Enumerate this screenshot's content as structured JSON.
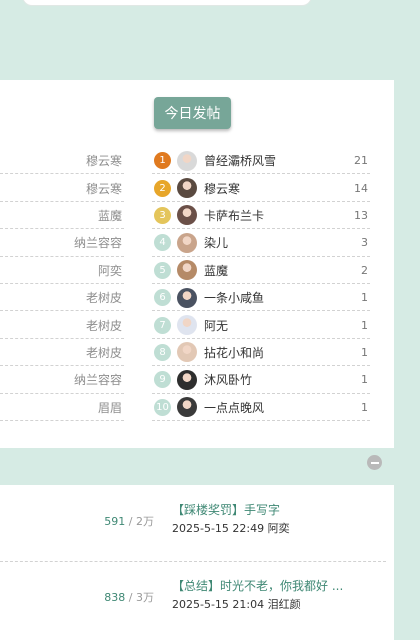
{
  "post_button_label": "今日发帖",
  "rank_colors": [
    "#e07a1f",
    "#e7a62a",
    "#e4c55b"
  ],
  "default_rank_color": "#bfded4",
  "ranking": [
    {
      "left_name": "穆云寒",
      "rank": "1",
      "user": "曾经灞桥风雪",
      "count": "21"
    },
    {
      "left_name": "穆云寒",
      "rank": "2",
      "user": "穆云寒",
      "count": "14"
    },
    {
      "left_name": "蓝魔",
      "rank": "3",
      "user": "卡萨布兰卡",
      "count": "13"
    },
    {
      "left_name": "纳兰容容",
      "rank": "4",
      "user": "染儿",
      "count": "3"
    },
    {
      "left_name": "阿奕",
      "rank": "5",
      "user": "蓝魔",
      "count": "2"
    },
    {
      "left_name": "老树皮",
      "rank": "6",
      "user": "一条小咸鱼",
      "count": "1"
    },
    {
      "left_name": "老树皮",
      "rank": "7",
      "user": "阿无",
      "count": "1"
    },
    {
      "left_name": "老树皮",
      "rank": "8",
      "user": "拈花小和尚",
      "count": "1"
    },
    {
      "left_name": "纳兰容容",
      "rank": "9",
      "user": "沐风卧竹",
      "count": "1"
    },
    {
      "left_name": "眉眉",
      "rank": "10",
      "user": "一点点晚风",
      "count": "1"
    }
  ],
  "threads": [
    {
      "views": "591",
      "sep": " / ",
      "replies": "2万",
      "title": "【踩楼奖罚】手写字",
      "meta": "2025-5-15 22:49 阿奕"
    },
    {
      "views": "838",
      "sep": " / ",
      "replies": "3万",
      "title": "【总结】时光不老，你我都好 ...",
      "meta": "2025-5-15 21:04 泪红颜"
    }
  ]
}
